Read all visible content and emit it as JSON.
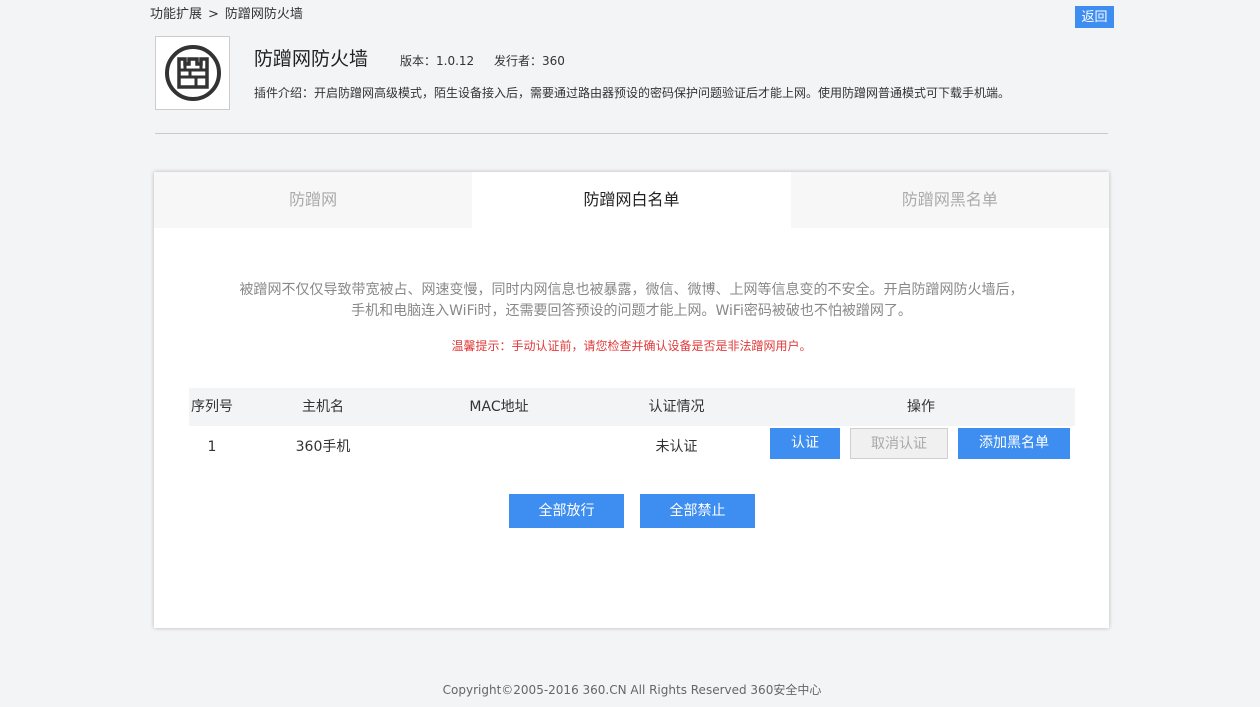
{
  "breadcrumb": {
    "parent": "功能扩展",
    "separator": ">",
    "current": "防蹭网防火墙"
  },
  "header": {
    "back_label": "返回"
  },
  "plugin": {
    "logo_icon": "castle-wall-icon",
    "title": "防蹭网防火墙",
    "version": "版本：1.0.12",
    "publisher": "发行者：360",
    "description": "插件介绍：开启防蹭网高级模式，陌生设备接入后，需要通过路由器预设的密码保护问题验证后才能上网。使用防蹭网普通模式可下载手机端。"
  },
  "tabs": [
    {
      "label": "防蹭网",
      "active": false
    },
    {
      "label": "防蹭网白名单",
      "active": true
    },
    {
      "label": "防蹭网黑名单",
      "active": false
    }
  ],
  "intro": {
    "line1": "被蹭网不仅仅导致带宽被占、网速变慢，同时内网信息也被暴露，微信、微博、上网等信息变的不安全。开启防蹭网防火墙后，",
    "line2": "手机和电脑连入WiFi时，还需要回答预设的问题才能上网。WiFi密码被破也不怕被蹭网了。",
    "warning": "温馨提示：手动认证前，请您检查并确认设备是否是非法蹭网用户。"
  },
  "table": {
    "headers": [
      "序列号",
      "主机名",
      "MAC地址",
      "认证情况",
      "操作"
    ],
    "rows": [
      {
        "index": "1",
        "hostname": "360手机",
        "mac": "",
        "status": "未认证"
      }
    ],
    "actions": {
      "auth": "认证",
      "cancel_auth": "取消认证",
      "add_blacklist": "添加黑名单"
    }
  },
  "bulk": {
    "allow_all": "全部放行",
    "block_all": "全部禁止"
  },
  "footer": {
    "copyright": "Copyright©2005-2016 360.CN All Rights Reserved 360安全中心"
  },
  "colors": {
    "accent": "#3d8ef0",
    "warning": "#e03a3a"
  }
}
